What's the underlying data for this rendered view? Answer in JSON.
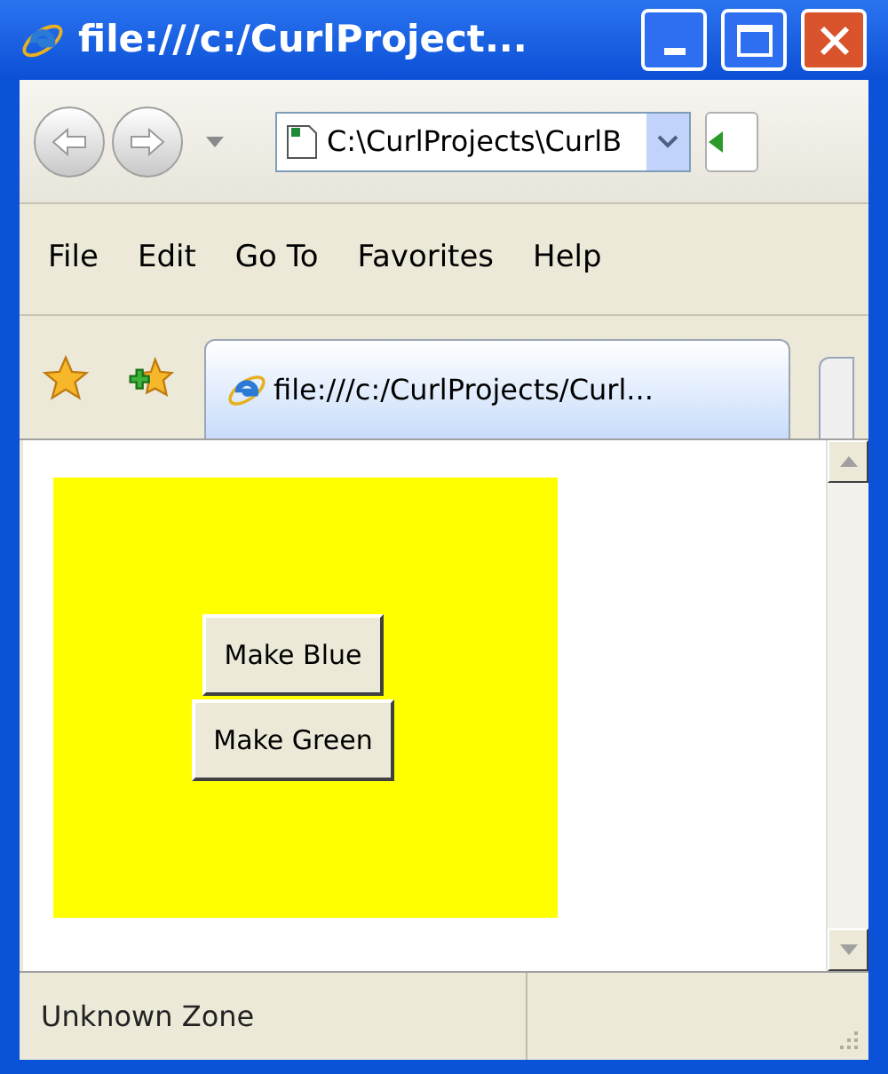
{
  "window": {
    "title": "file:///c:/CurlProject..."
  },
  "address_bar": {
    "value": "C:\\CurlProjects\\CurlB"
  },
  "menu": [
    "File",
    "Edit",
    "Go To",
    "Favorites",
    "Help"
  ],
  "tabs": [
    {
      "label": "file:///c:/CurlProjects/Curl...",
      "selected": true
    }
  ],
  "content": {
    "buttons": [
      "Make Blue",
      "Make Green"
    ]
  },
  "status_bar": {
    "zone": "Unknown Zone"
  }
}
